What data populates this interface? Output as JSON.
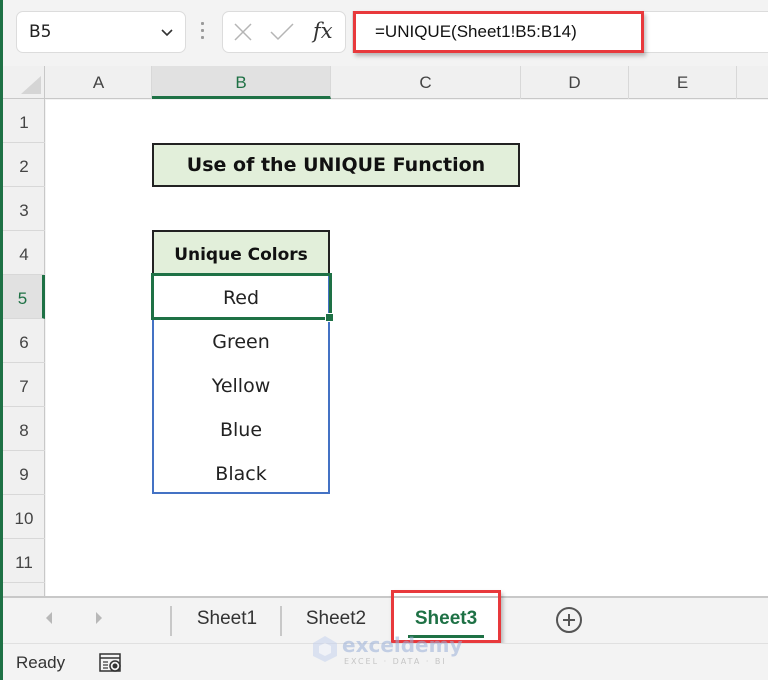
{
  "formula_bar": {
    "name_box": "B5",
    "cancel_icon": "x-icon",
    "enter_icon": "check-icon",
    "fx_label": "fx",
    "formula": "=UNIQUE(Sheet1!B5:B14)"
  },
  "columns": [
    "A",
    "B",
    "C",
    "D",
    "E"
  ],
  "active_column": "B",
  "rows": [
    "1",
    "2",
    "3",
    "4",
    "5",
    "6",
    "7",
    "8",
    "9",
    "10",
    "11"
  ],
  "active_row": "5",
  "cells": {
    "title": "Use of the UNIQUE Function",
    "list_header": "Unique Colors",
    "values": [
      "Red",
      "Green",
      "Yellow",
      "Blue",
      "Black"
    ]
  },
  "sheet_tabs": {
    "tabs": [
      "Sheet1",
      "Sheet2",
      "Sheet3"
    ],
    "active": "Sheet3",
    "add_icon": "plus-circle-icon"
  },
  "status_bar": {
    "status": "Ready",
    "macro_icon": "macro-record-icon"
  },
  "watermark": {
    "brand": "exceldemy",
    "tagline": "EXCEL · DATA · BI"
  },
  "colors": {
    "accent_green": "#1e7145",
    "header_fill": "#e2efda",
    "highlight_red": "#e8393c",
    "list_border_blue": "#4472c4"
  }
}
